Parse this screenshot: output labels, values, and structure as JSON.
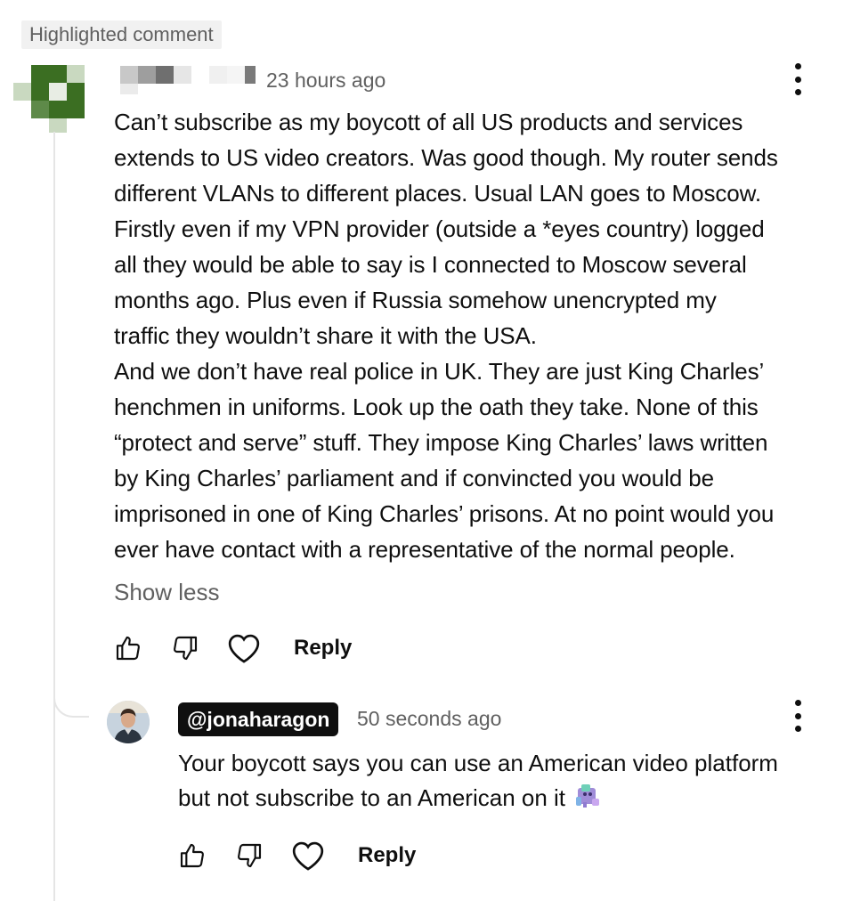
{
  "badge": {
    "label": "Highlighted comment"
  },
  "comment": {
    "timestamp": "23 hours ago",
    "text": "Can’t subscribe as my boycott of all US products and services\nextends to US video creators. Was good though. My router sends\ndifferent VLANs to different places. Usual LAN goes to Moscow.\nFirstly even if my VPN provider (outside a *eyes country) logged\nall they would be able to say is I connected to Moscow several\nmonths ago. Plus even if Russia somehow unencrypted my\ntraffic they wouldn’t share it with the USA.\nAnd we don’t have real police in UK. They are just King Charles’\nhenchmen in uniforms. Look up the oath they take. None of this\n“protect and serve” stuff. They impose King Charles’ laws written\nby King Charles’ parliament and if convincted you would be\nimprisoned in one of King Charles’ prisons. At no point would you\never have contact with a representative of the normal people.",
    "show_less": "Show less",
    "reply_label": "Reply",
    "avatar_color": "#3b6e22"
  },
  "reply": {
    "handle": "@jonaharagon",
    "timestamp": "50 seconds ago",
    "text": "Your boycott says you can use an American video platform\nbut not subscribe to an American on it",
    "reply_label": "Reply"
  },
  "icons": {
    "like": "thumbs-up-icon",
    "dislike": "thumbs-down-icon",
    "heart": "heart-icon",
    "more": "more-vert-icon",
    "emoji": "custom-emoji-sticker"
  }
}
